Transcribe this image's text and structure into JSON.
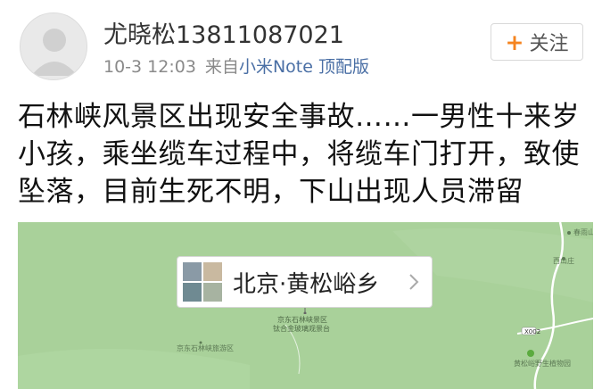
{
  "user": {
    "name": "尤晓松13811087021",
    "time": "10-3 12:03",
    "source_prefix": "来自",
    "source_app": "小米Note 顶配版"
  },
  "follow_button": {
    "label": "关注",
    "icon": "plus-icon"
  },
  "post": {
    "text": "石林峡风景区出现安全事故……一男性十来岁小孩，乘坐缆车过程中，将缆车门打开，致使坠落，目前生死不明，下山出现人员滞留"
  },
  "map": {
    "location_name": "北京·黄松峪乡",
    "poi_label_1": "京东石林峡景区",
    "poi_label_2": "钛合金玻璃观景台",
    "area_label": "京东石林峡旅游区",
    "top_right_label_1": "春雨山庄",
    "top_right_label_2": "西山庄",
    "road_label": "X002",
    "bottom_right_label": "黄松峪野生植物园",
    "colors": {
      "land": "#a9d19a",
      "road": "#ffffff"
    }
  }
}
